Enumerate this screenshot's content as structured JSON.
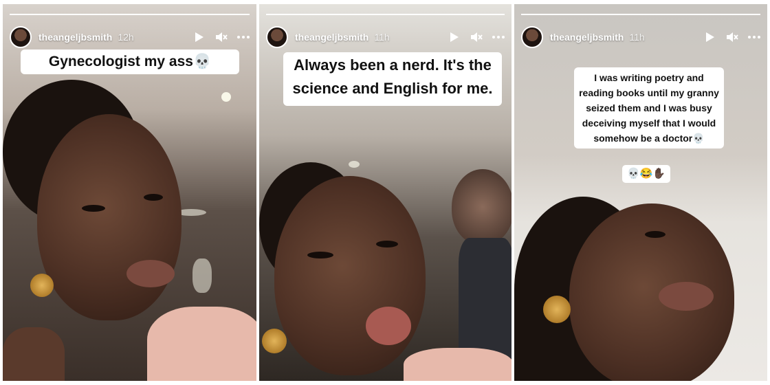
{
  "stories": [
    {
      "username": "theangeljbsmith",
      "time": "12h",
      "caption": "Gynecologist my ass💀",
      "icons": [
        "play-icon",
        "mute-icon",
        "more-icon"
      ]
    },
    {
      "username": "theangeljbsmith",
      "time": "11h",
      "caption": "Always been a nerd. It's the science and English for me.",
      "icons": [
        "play-icon",
        "mute-icon",
        "more-icon"
      ]
    },
    {
      "username": "theangeljbsmith",
      "time": "11h",
      "caption": "I was writing poetry and reading books until my granny seized them and I was busy deceiving myself that I would somehow be a doctor💀",
      "caption_emoji": "💀😂✋🏿",
      "icons": [
        "play-icon",
        "mute-icon",
        "more-icon"
      ]
    }
  ],
  "colors": {
    "caption_bg": "#ffffff",
    "text_on_photo": "#ffffff"
  }
}
